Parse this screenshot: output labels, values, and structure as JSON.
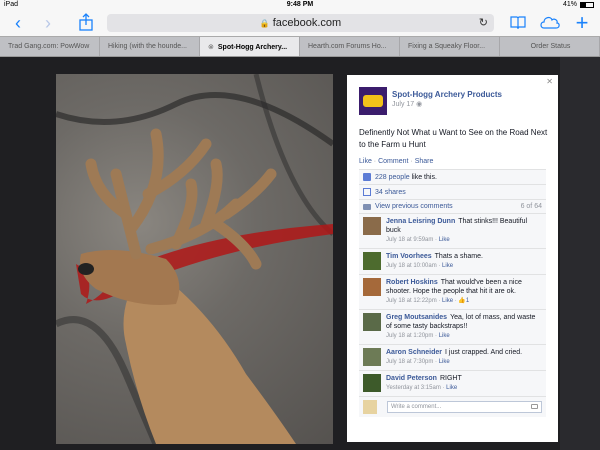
{
  "status": {
    "device": "iPad",
    "time": "9:48 PM",
    "battery": "41%"
  },
  "toolbar": {
    "url": "facebook.com"
  },
  "tabs": [
    {
      "label": "Trad Gang.com: PowWow",
      "active": false
    },
    {
      "label": "Hiking (with the hounde...",
      "active": false
    },
    {
      "label": "Spot-Hogg Archery...",
      "active": true
    },
    {
      "label": "Hearth.com Forums Ho...",
      "active": false
    },
    {
      "label": "Fixing a Squeaky Floor...",
      "active": false
    },
    {
      "label": "Order Status",
      "active": false
    }
  ],
  "post": {
    "page_name": "Spot-Hogg Archery Products",
    "date": "July 17",
    "text": "Definently Not What u Want to See on the Road Next to the Farm u Hunt",
    "actions": {
      "like": "Like",
      "comment": "Comment",
      "share": "Share"
    },
    "likes_count": "228 people",
    "likes_suffix": "like this.",
    "shares": "34 shares",
    "view_comments": "View previous comments",
    "comments_count": "6 of 64"
  },
  "comments": [
    {
      "author": "Jenna Leisring Dunn",
      "text": "That stinks!!! Beautiful buck",
      "time": "July 18 at 9:59am",
      "like": "Like",
      "avatar_color": "#8a6b4a"
    },
    {
      "author": "Tim Voorhees",
      "text": "Thats a shame.",
      "time": "July 18 at 10:00am",
      "like": "Like",
      "avatar_color": "#4d6b2e"
    },
    {
      "author": "Robert Hoskins",
      "text": "That would've been a nice shooter. Hope the people that hit it are ok.",
      "time": "July 18 at 12:22pm",
      "like": "Like",
      "likes": "1",
      "avatar_color": "#a5693a"
    },
    {
      "author": "Greg Moutsanides",
      "text": "Yea, lot of mass, and waste of some tasty backstraps!!",
      "time": "July 18 at 1:20pm",
      "like": "Like",
      "avatar_color": "#5a6a48"
    },
    {
      "author": "Aaron Schneider",
      "text": "I just crapped. And cried.",
      "time": "July 18 at 7:30pm",
      "like": "Like",
      "avatar_color": "#6d7b56"
    },
    {
      "author": "David Peterson",
      "text": "RIGHT",
      "time": "Yesterday at 3:15am",
      "like": "Like",
      "avatar_color": "#3d5a2a"
    }
  ],
  "write_comment": {
    "placeholder": "Write a comment..."
  },
  "colors": {
    "link": "#3b5998",
    "ios_blue": "#1a82fb"
  }
}
